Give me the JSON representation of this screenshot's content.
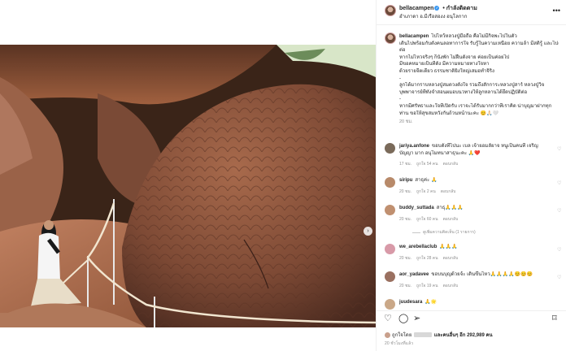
{
  "post": {
    "username": "bellacampen",
    "follow_label": "• กำลังติดตาม",
    "location": "อำเภาดา อ.มีเรือสองง อนุโลกาก",
    "more_icon": "ellipsis-icon",
    "accent_color": "#3897f0"
  },
  "caption": {
    "username": "bellacampen",
    "lines": [
      "ไปไหว้หลวงปู่มือถือ คือไม่มีกิจพะไปในตัว",
      "เดินไปพร้อมกับตั้งคนลอทาการใจ รับรู้ในความเหนื่อย ความล้า มีสติรู้ และไปด้",
      "ต่อ",
      "หากไม่ไหวจริงๆ ก็นั่งพัก ไม่ฝืนตั้งจาย ค่อยเป็นค่อยไป",
      "มีขอคหมายเป็นที่ตั้ง มีความหมายทางใจหา",
      "ด้วยรายจีตเดียว ธรรมชาติยิ่งใหญ่เสมอทำจิริง",
      "-",
      "ลูกได้มากราบหลวงปู่สมดวงตั้งใจ รวมถึงสักการะหลวงปู่สาร์ หลวงปู่วิจ",
      "บุพพาจารย์ที่ทั้งจำสอนผมอบนวทางให้ลูกหลานได้ยึดปฏิบัติต่อ",
      "-",
      "หากมีศรัทธาและใจที่เปิดรับ เราจะได้รับมากกว่าที่เราคิด น่าบุญมาฝากทุก",
      "ท่าน ขอให้สุขสมหวังกันถ้วนหน้านะคะ 😊🙏🏻🤍"
    ],
    "time": "20 ชม."
  },
  "comments": [
    {
      "username": "jariya.anfone",
      "text": "ขอบตั้งที่ไปนะ เบล เจ้ายอมลัยาจ หนูเป็นคนที่ เจริญ",
      "text2": "บัญญา มาก อนุโมทนาสาธุนะคะ 🙏❤️",
      "time": "17 ชม.",
      "likes": "ถูกใจ 54 คน",
      "reply": "ตอบกลับ",
      "avatar_color": "#7a6a5a"
    },
    {
      "username": "siripu",
      "text": "สาธุค่ะ 🙏",
      "time": "20 ชม.",
      "likes": "ถูกใจ 2 คน",
      "reply": "ตอบกลับ",
      "avatar_color": "#b88a6a"
    },
    {
      "username": "buddy_suttada",
      "text": "สาธุ🙏🙏🙏",
      "time": "20 ชม.",
      "likes": "ถูกใจ 60 คน",
      "reply": "ตอบกลับ",
      "replies_label": "ดูเพิ่มความคิดเห็น (1 รายการ)",
      "avatar_color": "#c09070"
    },
    {
      "username": "we_arebellaclub",
      "text": "🙏🙏🙏",
      "time": "20 ชม.",
      "likes": "ถูกใจ 28 คน",
      "reply": "ตอบกลับ",
      "avatar_color": "#d89aa8"
    },
    {
      "username": "aor_yadavee",
      "text": "ขอบนบุญด้วยจ้ะ เดินขึ้นไหว🙏🙏🙏🙏😊😊😊",
      "time": "20 ชม.",
      "likes": "ถูกใจ 19 คน",
      "reply": "ตอบกลับ",
      "avatar_color": "#9a7060"
    },
    {
      "username": "juudesara",
      "text": "🙏🌟",
      "avatar_color": "#caa888"
    }
  ],
  "actions": {
    "like_icon": "heart-icon",
    "comment_icon": "comment-icon",
    "share_icon": "paper-plane-icon",
    "save_icon": "bookmark-icon"
  },
  "likes": {
    "prefix": "ถูกใจโดย",
    "and_label": "และคนอื่นๆ อีก",
    "count": "292,989 คน"
  },
  "date": "20 ชั่วโมงที่แล้ว"
}
